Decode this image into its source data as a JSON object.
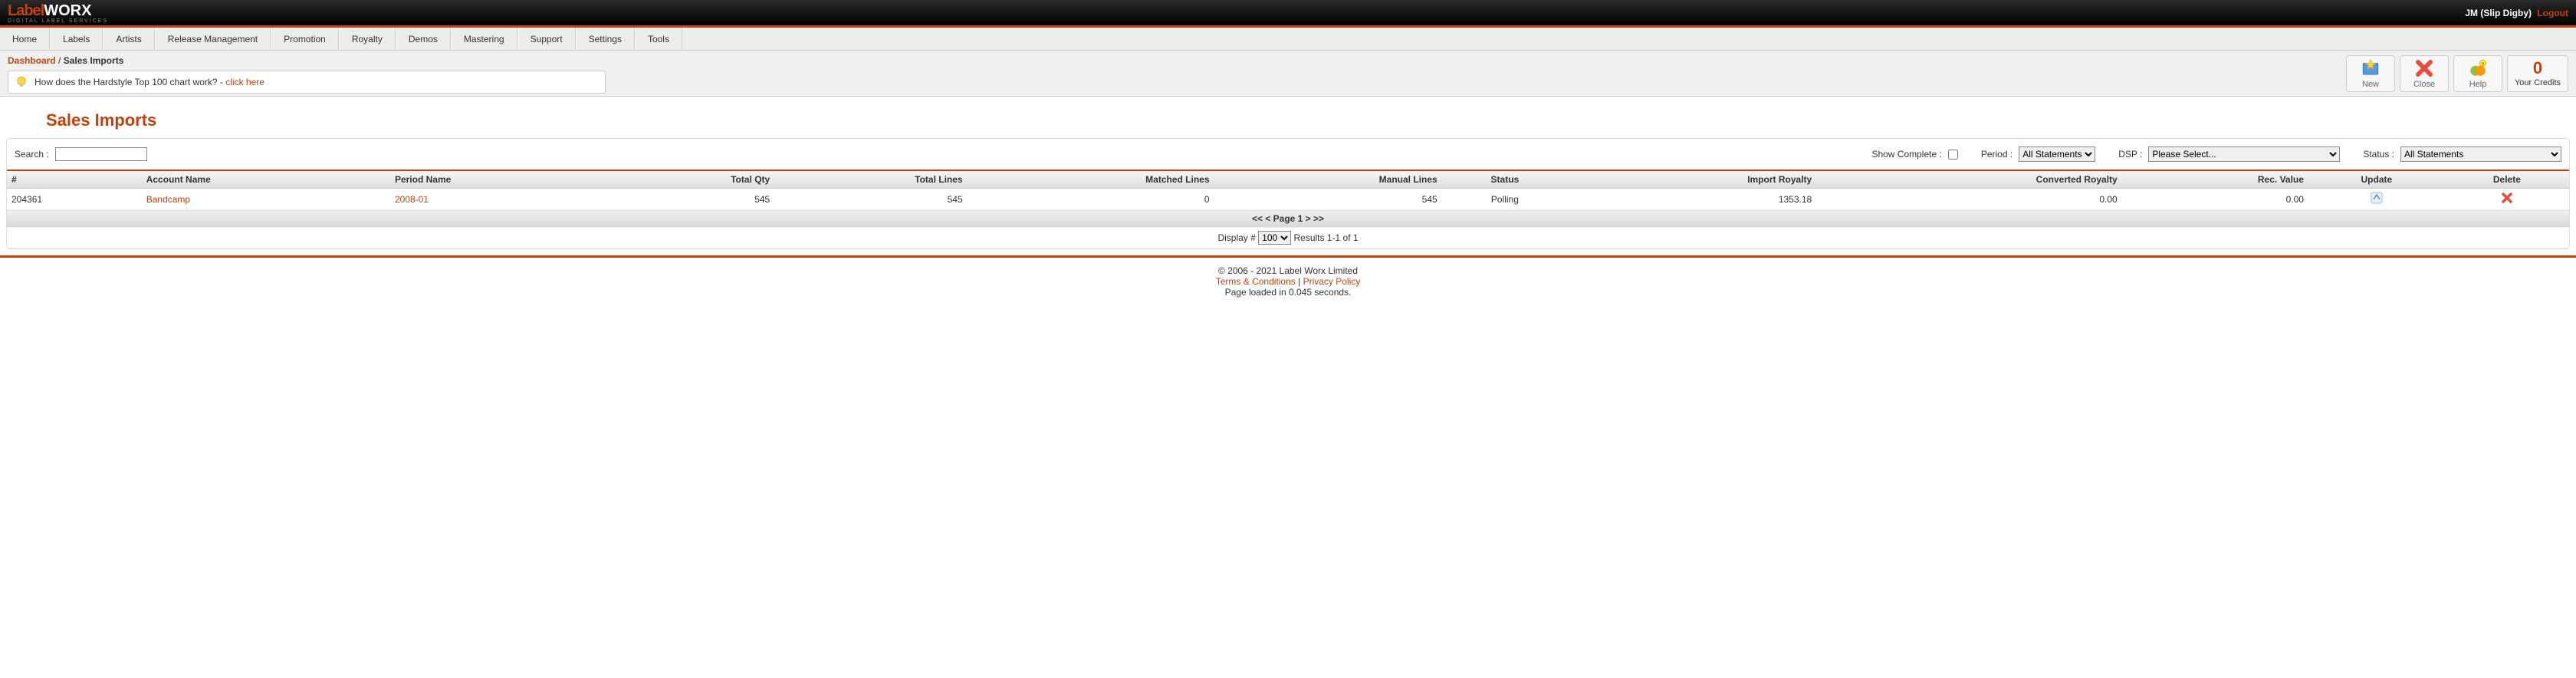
{
  "topbar": {
    "user": "JM (Slip Digby)",
    "logout": "Logout",
    "logo_label": "Label",
    "logo_worx": "WORX",
    "logo_sub": "DIGITAL LABEL SERVICES"
  },
  "nav": {
    "items": [
      "Home",
      "Labels",
      "Artists",
      "Release Management",
      "Promotion",
      "Royalty",
      "Demos",
      "Mastering",
      "Support",
      "Settings",
      "Tools"
    ]
  },
  "breadcrumb": {
    "root": "Dashboard",
    "sep": " / ",
    "current": "Sales Imports"
  },
  "tip": {
    "text": "How does the Hardstyle Top 100 chart work? - ",
    "link": "click here"
  },
  "actions": {
    "new": "New",
    "close": "Close",
    "help": "Help",
    "credits_num": "0",
    "credits_label": "Your Credits"
  },
  "page_title": "Sales Imports",
  "filters": {
    "search_label": "Search :",
    "show_complete_label": "Show Complete :",
    "period_label": "Period :",
    "period_value": "All Statements",
    "dsp_label": "DSP :",
    "dsp_value": "Please Select...",
    "status_label": "Status :",
    "status_value": "All Statements"
  },
  "table": {
    "headers": {
      "id": "#",
      "account": "Account Name",
      "period": "Period Name",
      "total_qty": "Total Qty",
      "total_lines": "Total Lines",
      "matched_lines": "Matched Lines",
      "manual_lines": "Manual Lines",
      "status": "Status",
      "import_royalty": "Import Royalty",
      "converted_royalty": "Converted Royalty",
      "rec_value": "Rec. Value",
      "update": "Update",
      "delete": "Delete"
    },
    "rows": [
      {
        "id": "204361",
        "account": "Bandcamp",
        "period": "2008-01",
        "total_qty": "545",
        "total_lines": "545",
        "matched_lines": "0",
        "manual_lines": "545",
        "status": "Polling",
        "import_royalty": "1353.18",
        "converted_royalty": "0.00",
        "rec_value": "0.00"
      }
    ],
    "pager": "<< < Page 1 > >>",
    "display_label": "Display #",
    "display_value": "100",
    "results": "Results 1-1 of 1"
  },
  "footer": {
    "copyright": "© 2006 - 2021 Label Worx Limited",
    "terms": "Terms & Conditions",
    "sep": " | ",
    "privacy": "Privacy Policy",
    "loaded": "Page loaded in 0.045 seconds."
  }
}
